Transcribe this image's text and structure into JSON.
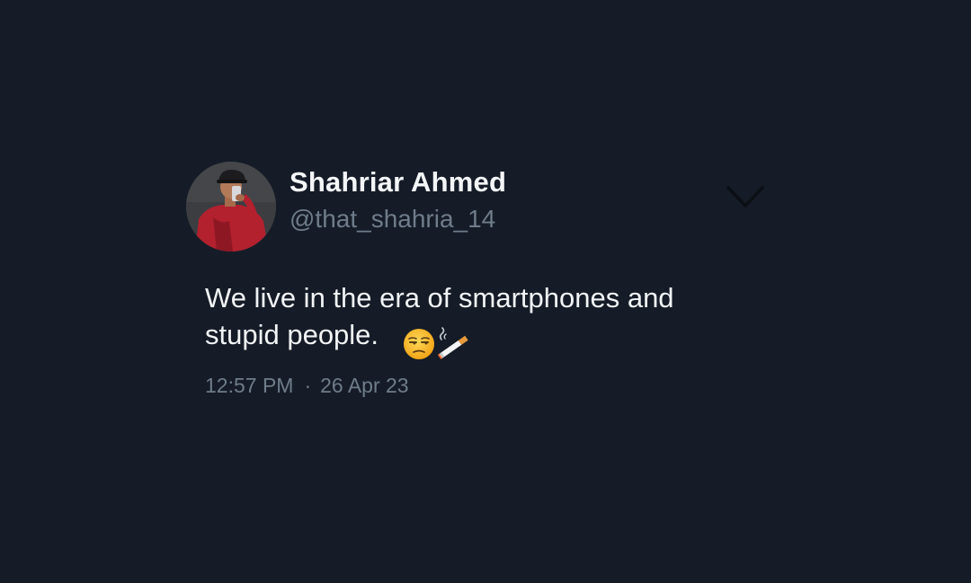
{
  "tweet": {
    "author": {
      "display_name": "Shahriar Ahmed",
      "handle": "@that_shahria_14"
    },
    "text_line1": "We live in the era of smartphones and",
    "text_line2": "stupid people.",
    "emojis": [
      "unamused-face",
      "cigarette"
    ],
    "time": "12:57 PM",
    "separator": "·",
    "date": "26 Apr 23"
  },
  "icons": {
    "menu": "chevron-down-icon"
  },
  "colors": {
    "background": "#151c27",
    "primary_text": "#f2f4f6",
    "secondary_text": "#6f7c8a",
    "chevron": "#0b0f15"
  }
}
